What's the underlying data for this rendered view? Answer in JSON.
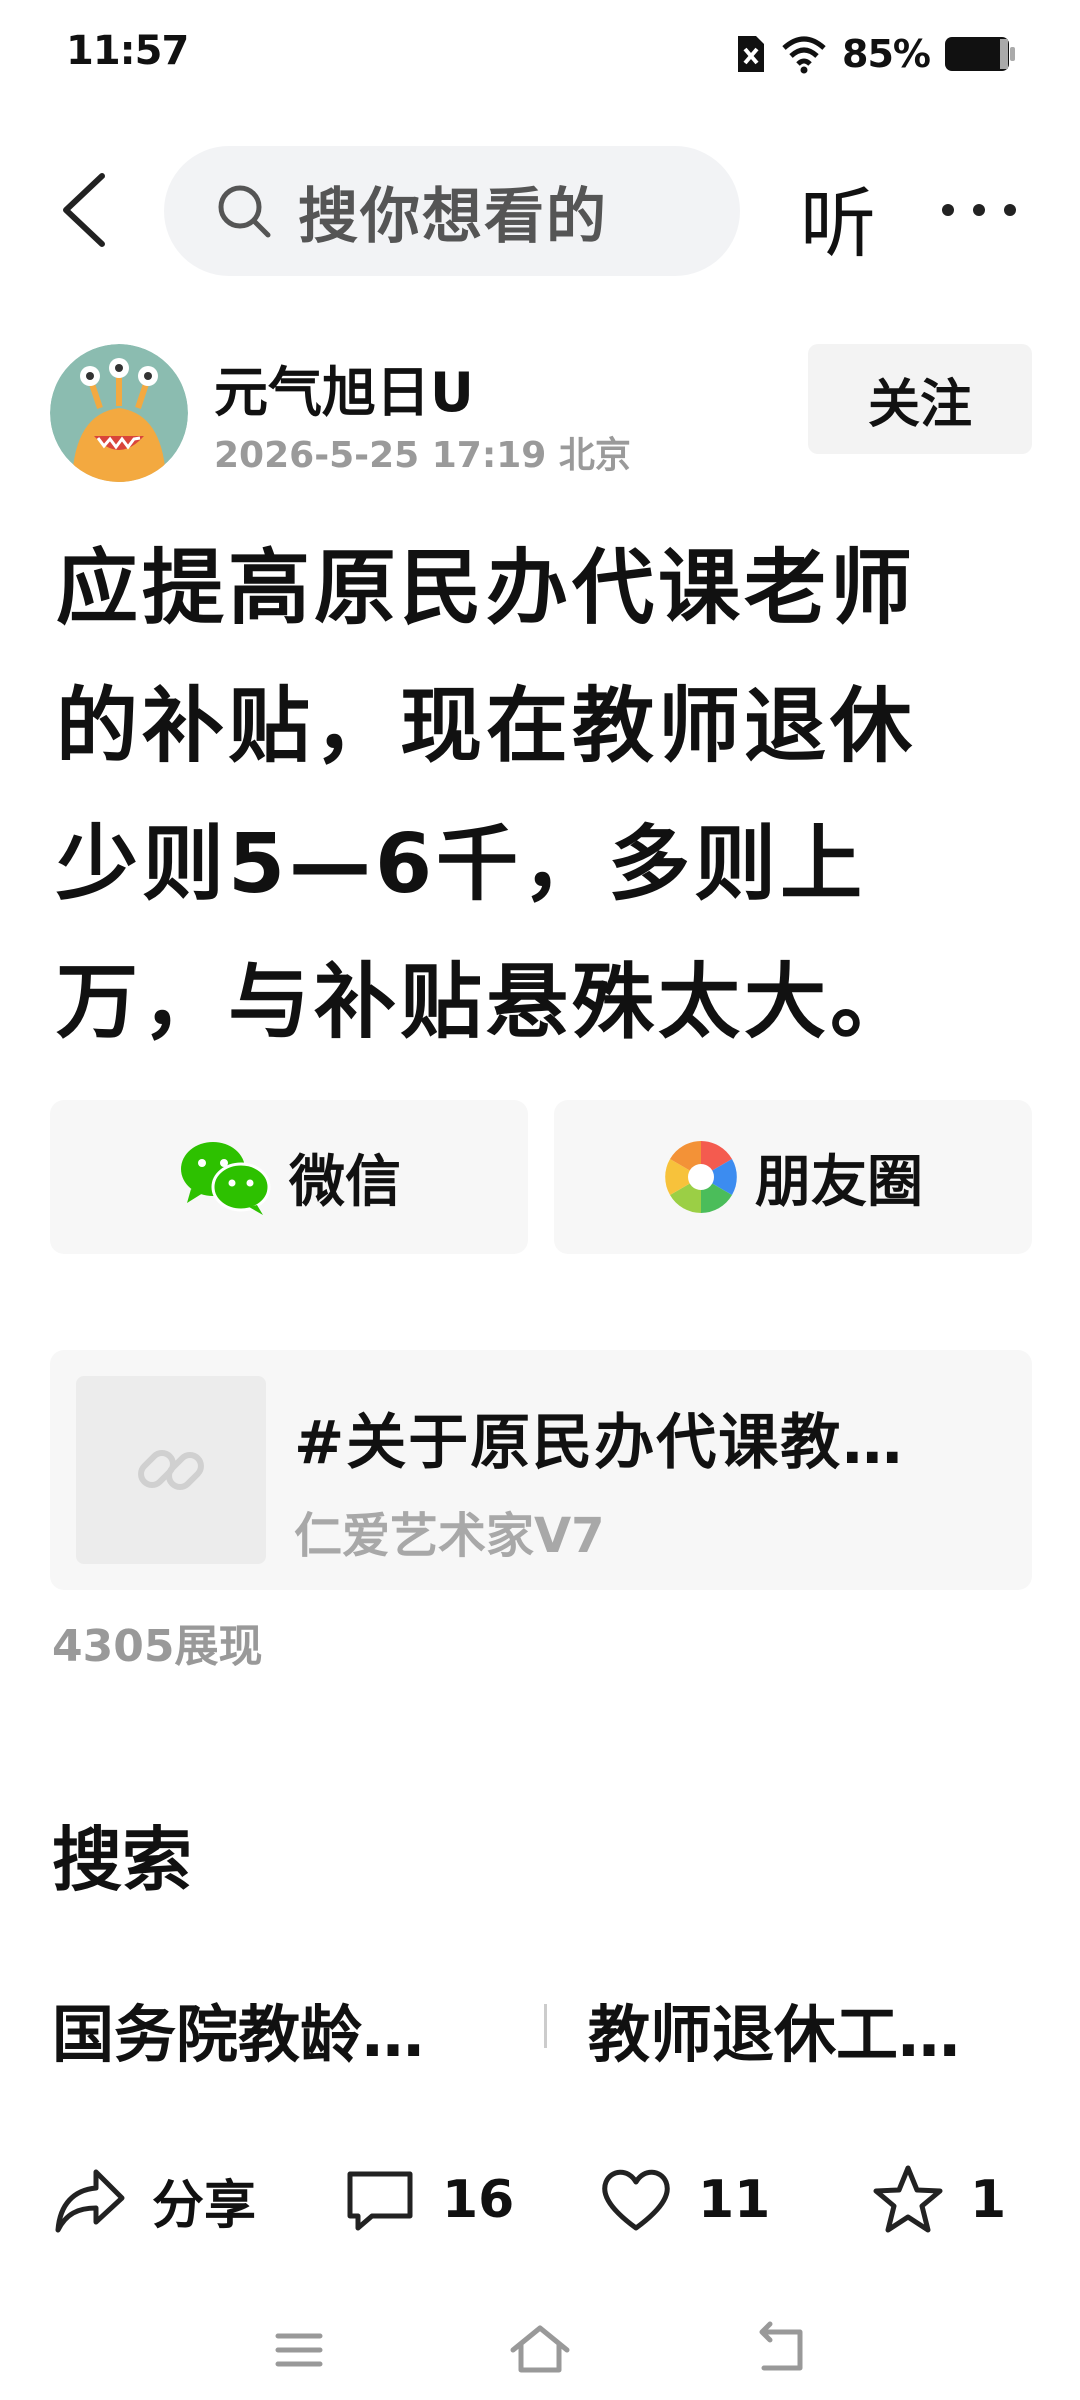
{
  "status_bar": {
    "time": "11:57",
    "battery": "85%"
  },
  "top_bar": {
    "search_placeholder": "搜你想看的",
    "listen_label": "听"
  },
  "author": {
    "name": "元气旭日U",
    "meta": "2026-5-25  17:19 北京",
    "follow_label": "关注"
  },
  "article": {
    "title": "应提高原民办代课老师的补贴，现在教师退休少则5—6千，多则上万，与补贴悬殊太大。"
  },
  "share": {
    "wechat_label": "微信",
    "moments_label": "朋友圈"
  },
  "link_card": {
    "title": "#关于原民办代课教…",
    "author": "仁爱艺术家V7"
  },
  "views": "4305展现",
  "search_section": {
    "heading": "搜索",
    "suggestions": [
      "国务院教龄…",
      "教师退休工…"
    ]
  },
  "actions": {
    "share_label": "分享",
    "comments": "16",
    "likes": "11",
    "favorites": "1"
  },
  "colors": {
    "wechat_green": "#2dc100",
    "follow_bg": "#f3f3f3",
    "search_bg": "#f2f3f5"
  }
}
